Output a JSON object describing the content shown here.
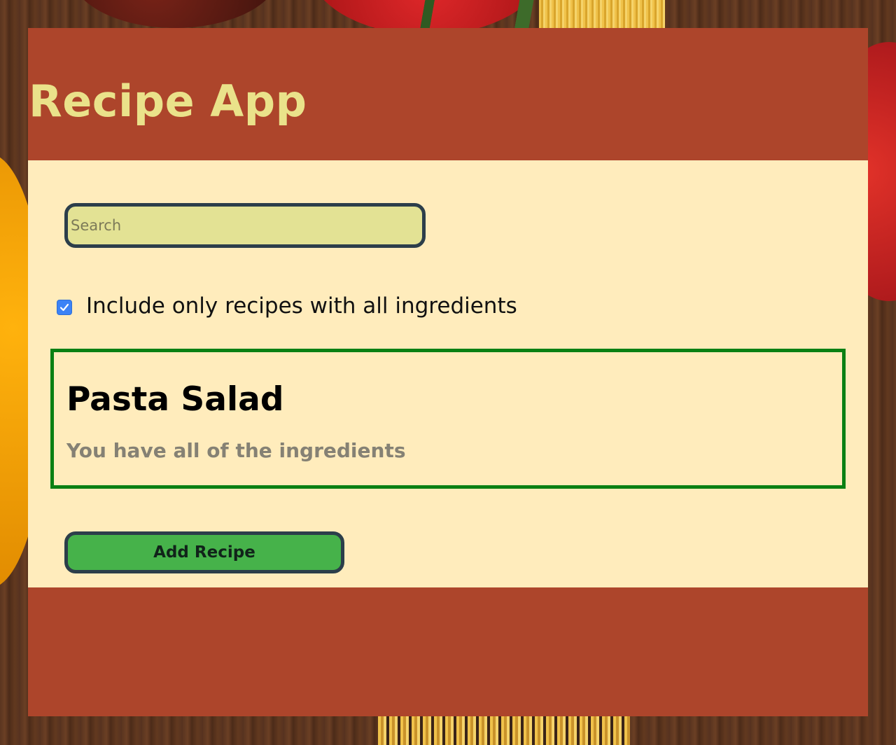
{
  "header": {
    "title": "Recipe App"
  },
  "search": {
    "placeholder": "Search",
    "value": ""
  },
  "filter": {
    "label": "Include only recipes with all ingredients",
    "checked": true
  },
  "recipes": [
    {
      "name": "Pasta Salad",
      "status": "You have all of the ingredients"
    }
  ],
  "actions": {
    "add_recipe_label": "Add Recipe"
  },
  "colors": {
    "header_bg": "#ad452b",
    "title_text": "#eae28a",
    "main_bg": "#ffecbc",
    "search_bg": "#e3e294",
    "card_border": "#0a8013",
    "button_bg": "#46b24a",
    "control_border": "#2c3e4a",
    "checkbox_accent": "#3b82f6"
  }
}
